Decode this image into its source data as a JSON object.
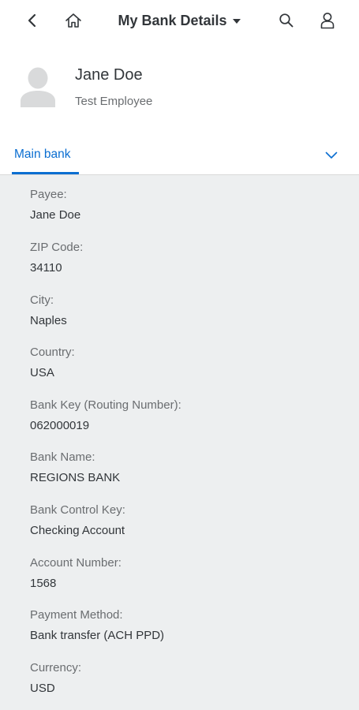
{
  "header": {
    "title": "My Bank Details",
    "icons": {
      "back": "chevron-left-icon",
      "home": "home-icon",
      "title_menu": "caret-down-icon",
      "search": "search-icon",
      "user": "user-icon"
    }
  },
  "profile": {
    "name": "Jane Doe",
    "subtitle": "Test Employee",
    "avatar_icon": "person-placeholder-icon"
  },
  "tabs": {
    "active_label": "Main bank",
    "expand_icon": "chevron-down-icon",
    "accent_color": "#0a6ed1"
  },
  "details": {
    "fields": [
      {
        "label": "Payee:",
        "value": "Jane Doe"
      },
      {
        "label": "ZIP Code:",
        "value": "34110"
      },
      {
        "label": "City:",
        "value": "Naples"
      },
      {
        "label": "Country:",
        "value": "USA"
      },
      {
        "label": "Bank Key (Routing Number):",
        "value": "062000019"
      },
      {
        "label": "Bank Name:",
        "value": "REGIONS BANK"
      },
      {
        "label": "Bank Control Key:",
        "value": "Checking Account"
      },
      {
        "label": "Account Number:",
        "value": "1568"
      },
      {
        "label": "Payment Method:",
        "value": "Bank transfer (ACH PPD)"
      },
      {
        "label": "Currency:",
        "value": "USD"
      }
    ]
  }
}
